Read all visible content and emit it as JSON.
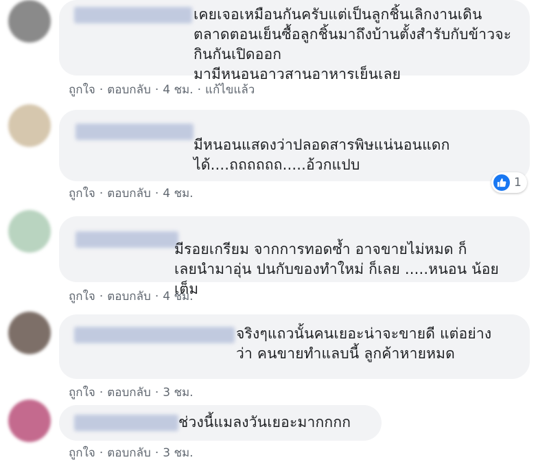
{
  "actions": {
    "like": "ถูกใจ",
    "reply": "ตอบกลับ",
    "edited": "แก้ไขแล้ว",
    "sep": "·"
  },
  "comments": [
    {
      "text": "เคยเจอเหมือนกันครับแต่เป็นลูกชิ้นเลิกงานเดิน\nตลาดตอนเย็นซื้อลูกชิ้นมาถึงบ้านตั้งสำรับกับข้าวจะกินกันเปิดออก\nมามีหนอนอาวสานอาหารเย็นเลย",
      "time": "4 ชม.",
      "avatar_color": "#8a8a8a"
    },
    {
      "text": "มีหนอนแสดงว่าปลอดสารพิษแน่นอนแดก\nได้....ถถถถถถ.....อ้วกแปบ",
      "time": "4 ชม.",
      "avatar_color": "#d6c7ae",
      "reaction_count": "1",
      "reaction_icon": "like-icon"
    },
    {
      "text": "มีรอยเกรียม จากการทอดซ้ำ อาจขายไม่หมด ก็\nเลยนำมาอุ่น ปนกับของทำใหม่ ก็เลย .....หนอน น้อยเต็ม",
      "time": "4 ชม.",
      "avatar_color": "#b9d4c0"
    },
    {
      "text": "จริงๆแถวนั้นคนเยอะน่าจะขายดี แต่อย่าง\nว่า คนขายทำแลบนี้ ลูกค้าหายหมด",
      "time": "3 ชม.",
      "avatar_color": "#7d6f68"
    },
    {
      "text": "ช่วงนี้แมลงวันเยอะมากกกก",
      "time": "3 ชม.",
      "avatar_color": "#c46a8e"
    }
  ]
}
